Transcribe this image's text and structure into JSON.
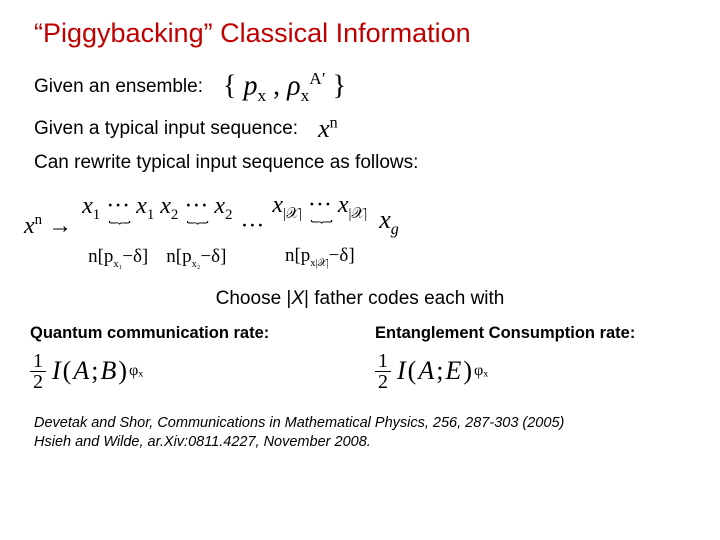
{
  "title": "“Piggybacking” Classical Information",
  "lines": {
    "ensemble_label": "Given an ensemble:",
    "typical_label": "Given a typical input sequence:",
    "rewrite_label": "Can rewrite typical input sequence as follows:"
  },
  "ensemble_math": "{ pₓ , ρₓ }",
  "ensemble_rho_sup": "A′",
  "xn_base": "x",
  "xn_sup": "n",
  "diagram": {
    "lhs": "x",
    "lhs_sup": "n",
    "arrow": "→",
    "groups": [
      {
        "top": "x₁ ··· x₁",
        "below_a": "n[p",
        "below_sub": "x₁",
        "below_c": "−δ]"
      },
      {
        "top": "x₂ ··· x₂",
        "below_a": "n[p",
        "below_sub": "x₂",
        "below_c": "−δ]"
      },
      {
        "top": "x|𝒳| ··· x|𝒳|",
        "below_a": "n[p",
        "below_sub": "x|𝒳|",
        "below_c": "−δ]"
      }
    ],
    "trail": "x",
    "trail_sub": "g"
  },
  "choose_text": "Choose |X| father codes each with",
  "rates": {
    "q_label": "Quantum communication rate:",
    "q_expr_I": "I(A; B)",
    "q_expr_sub": "φₓ",
    "e_label": "Entanglement Consumption rate:",
    "e_expr_I": "I(A; E)",
    "e_expr_sub": "φₓ"
  },
  "refs": {
    "r1": "Devetak and Shor, Communications in Mathematical Physics, 256, 287-303 (2005)",
    "r2": "Hsieh and Wilde, ar.Xiv:0811.4227, November 2008."
  }
}
